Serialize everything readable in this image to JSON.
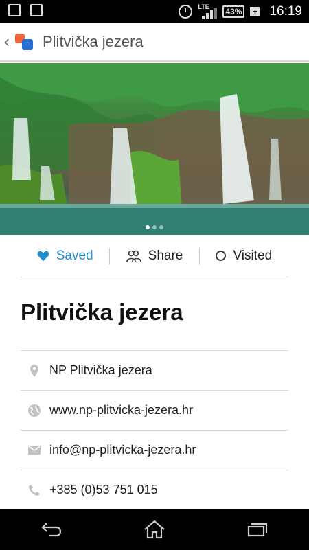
{
  "status_bar": {
    "network": "LTE",
    "battery": "43%",
    "time": "16:19"
  },
  "app_bar": {
    "title": "Plitvička jezera"
  },
  "hero": {
    "slide_count": 3,
    "active_slide": 1
  },
  "actions": {
    "saved_label": "Saved",
    "share_label": "Share",
    "visited_label": "Visited"
  },
  "place": {
    "title": "Plitvička jezera"
  },
  "info": [
    {
      "icon": "location-pin-icon",
      "text": "NP Plitvička jezera"
    },
    {
      "icon": "globe-icon",
      "text": "www.np-plitvicka-jezera.hr"
    },
    {
      "icon": "mail-icon",
      "text": "info@np-plitvicka-jezera.hr"
    },
    {
      "icon": "phone-icon",
      "text": "+385 (0)53 751 015"
    }
  ],
  "colors": {
    "accent": "#1e8fd1"
  }
}
